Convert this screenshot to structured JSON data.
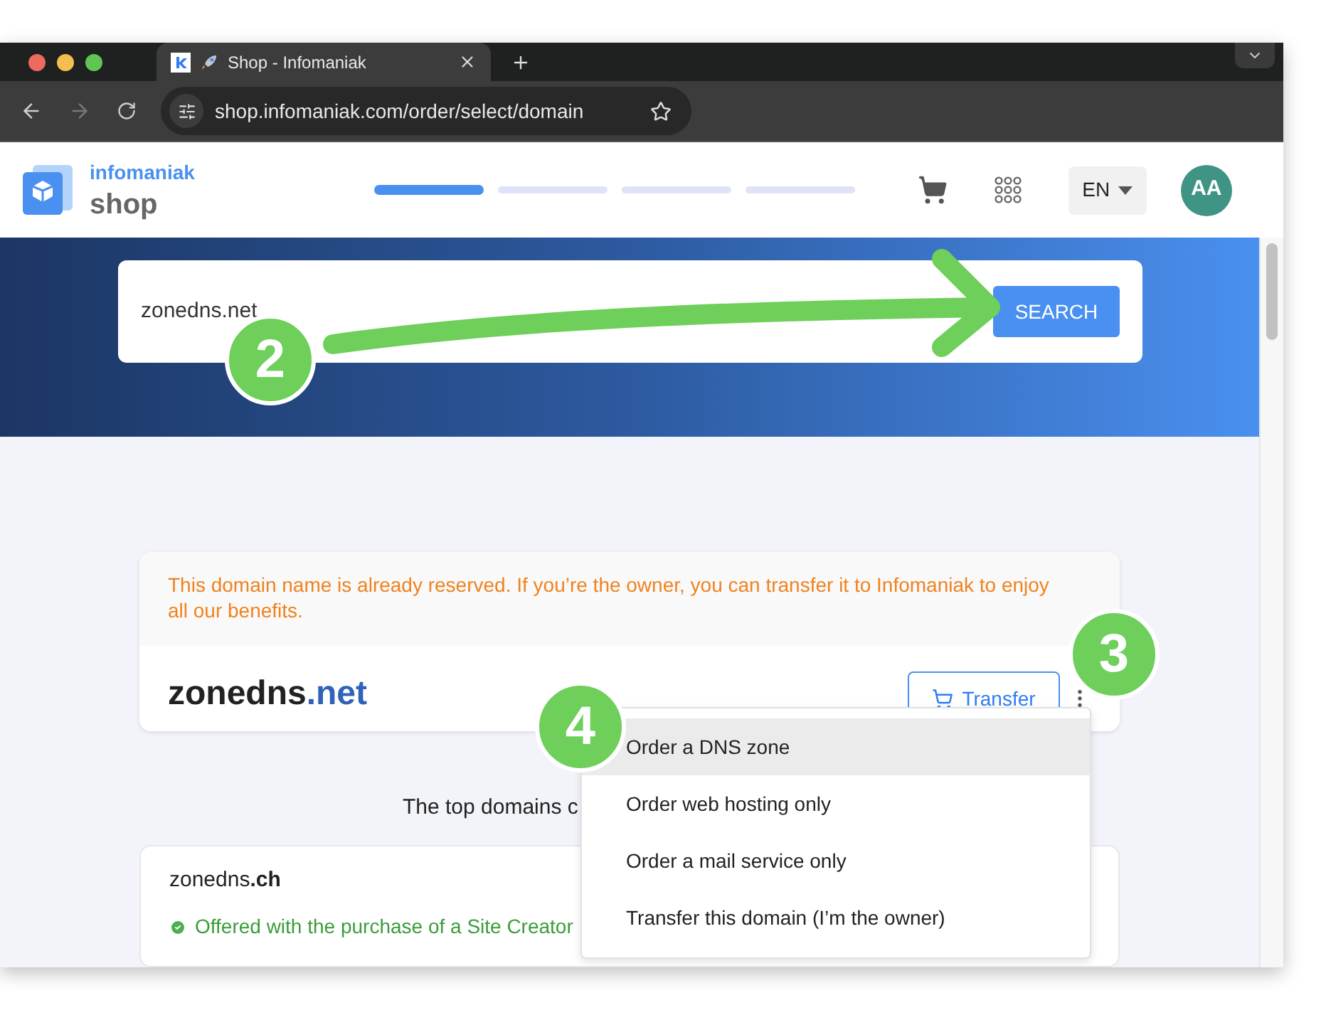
{
  "browser": {
    "tab_title": "Shop - Infomaniak",
    "url": "shop.infomaniak.com/order/select/domain"
  },
  "header": {
    "brand": "infomaniak",
    "product": "shop",
    "steps": [
      {
        "selected": true
      },
      {
        "selected": false
      },
      {
        "selected": false
      },
      {
        "selected": false
      }
    ],
    "language": "EN",
    "avatar": "AA"
  },
  "search": {
    "value": "zonedns.net",
    "button": "SEARCH"
  },
  "result": {
    "notice": "This domain name is already reserved. If you’re the owner, you can transfer it to Infomaniak to enjoy all our benefits.",
    "domain_name": "zonedns",
    "domain_tld": ".net",
    "transfer_button": "Transfer"
  },
  "menu": [
    {
      "label": "Order a DNS zone",
      "selected": true
    },
    {
      "label": "Order web hosting only",
      "selected": false
    },
    {
      "label": "Order a mail service only",
      "selected": false
    },
    {
      "label": "Transfer this domain (I’m the owner)",
      "selected": false
    }
  ],
  "top_domains": {
    "heading": "The top domains c",
    "items": [
      {
        "name": "zonedns",
        "tld": ".ch",
        "offer": "Offered with the purchase of a Site Creator"
      }
    ]
  },
  "annotations": [
    "2",
    "3",
    "4"
  ]
}
